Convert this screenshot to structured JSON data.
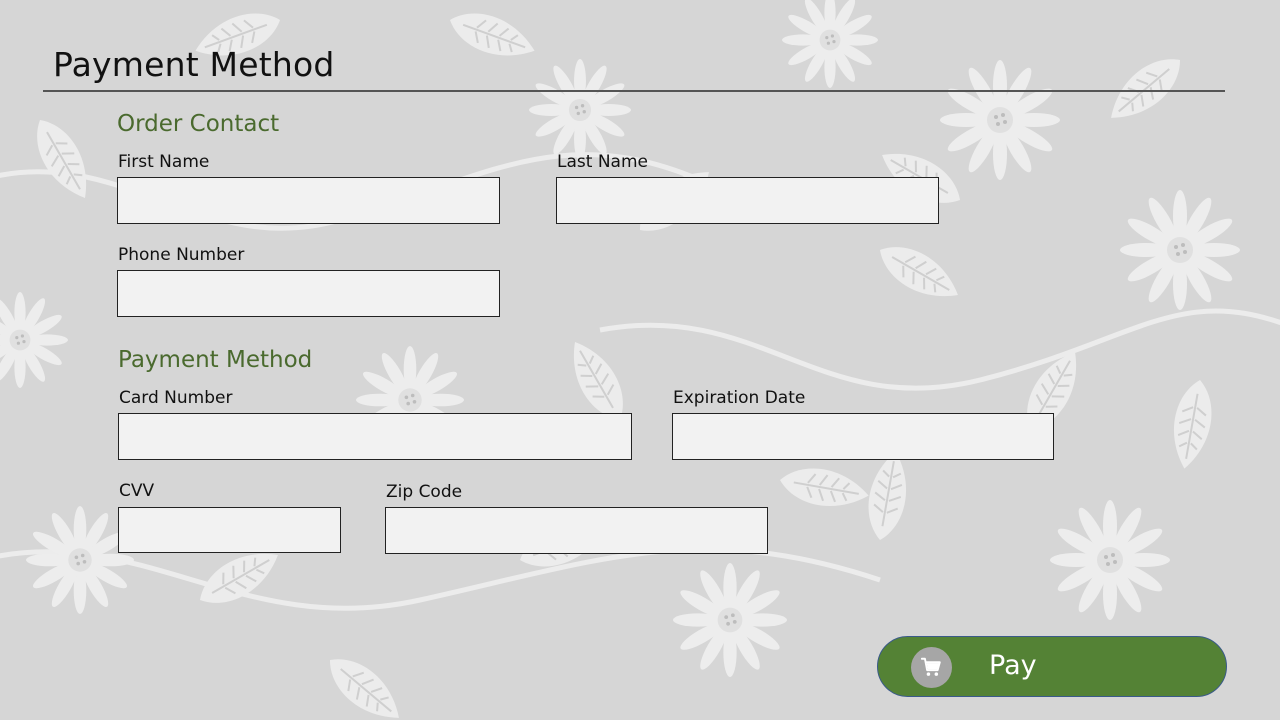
{
  "header": {
    "title": "Payment Method"
  },
  "order_contact": {
    "heading": "Order Contact",
    "first_name": {
      "label": "First Name",
      "value": ""
    },
    "last_name": {
      "label": "Last Name",
      "value": ""
    },
    "phone_number": {
      "label": "Phone Number",
      "value": ""
    }
  },
  "payment_method": {
    "heading": "Payment Method",
    "card_number": {
      "label": "Card Number",
      "value": ""
    },
    "expiration_date": {
      "label": "Expiration Date",
      "value": ""
    },
    "cvv": {
      "label": "CVV",
      "value": ""
    },
    "zip_code": {
      "label": "Zip Code",
      "value": ""
    }
  },
  "pay_button": {
    "label": "Pay",
    "icon": "shopping-cart-icon"
  },
  "colors": {
    "accent_green": "#548235",
    "heading_green": "#4a6a2e",
    "background_gray": "#d6d6d6",
    "input_fill": "#f2f2f2",
    "cart_circle": "#a6a6a6"
  }
}
